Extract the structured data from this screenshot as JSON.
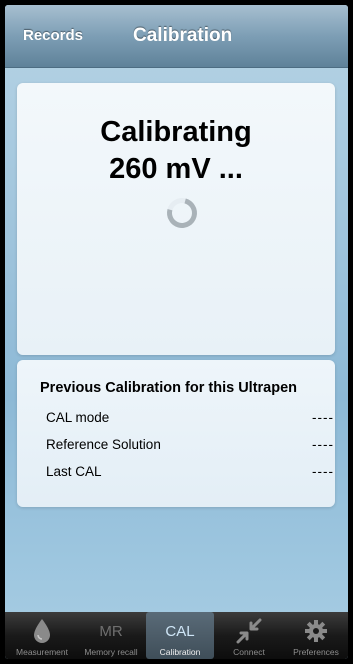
{
  "header": {
    "back_label": "Records",
    "title": "Calibration"
  },
  "status": {
    "line1": "Calibrating",
    "line2": "260 mV ..."
  },
  "previous": {
    "title": "Previous Calibration for this Ultrapen",
    "rows": [
      {
        "label": "CAL mode",
        "value": "----"
      },
      {
        "label": "Reference Solution",
        "value": "----"
      },
      {
        "label": "Last CAL",
        "value": "----"
      }
    ]
  },
  "tabs": [
    {
      "label": "Measurement",
      "icon": "drop-icon",
      "active": false
    },
    {
      "label": "Memory recall",
      "text": "MR",
      "active": false
    },
    {
      "label": "Calibration",
      "text": "CAL",
      "active": true
    },
    {
      "label": "Connect",
      "icon": "connect-arrows-icon",
      "active": false
    },
    {
      "label": "Preferences",
      "icon": "gear-icon",
      "active": false
    }
  ],
  "colors": {
    "accent_active_tab": "#4a5a66",
    "background": "#9fc4dc"
  }
}
